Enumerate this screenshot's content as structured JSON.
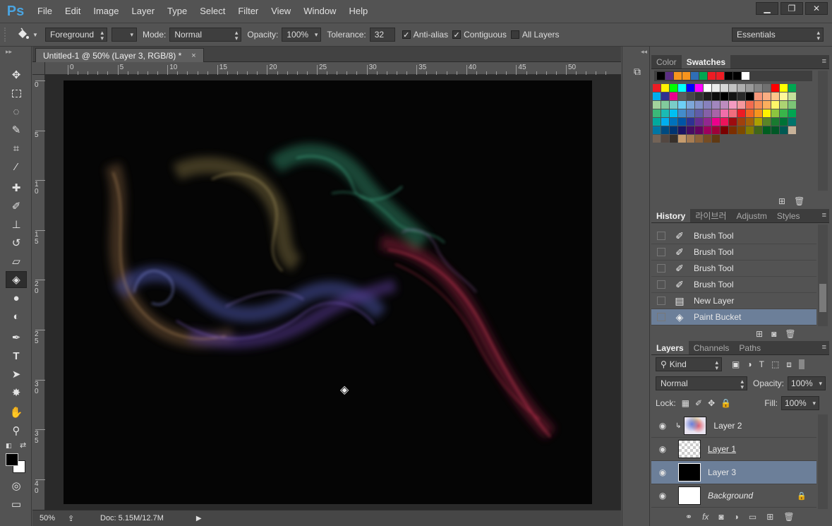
{
  "app": {
    "logo": "Ps",
    "menus": [
      "File",
      "Edit",
      "Image",
      "Layer",
      "Type",
      "Select",
      "Filter",
      "View",
      "Window",
      "Help"
    ],
    "window_controls": [
      "▁",
      "❐",
      "✕"
    ]
  },
  "options": {
    "fill_source": "Foreground",
    "mode_label": "Mode:",
    "mode_value": "Normal",
    "opacity_label": "Opacity:",
    "opacity_value": "100%",
    "tolerance_label": "Tolerance:",
    "tolerance_value": "32",
    "anti_alias": "Anti-alias",
    "contiguous": "Contiguous",
    "all_layers": "All Layers",
    "workspace": "Essentials"
  },
  "document": {
    "tab_title": "Untitled-1 @ 50% (Layer 3, RGB/8) *",
    "close": "×",
    "ruler_top": [
      "0",
      "5",
      "10",
      "15",
      "20",
      "25",
      "30",
      "35",
      "40",
      "45",
      "50"
    ],
    "ruler_left": [
      "0",
      "5",
      "1\n0",
      "1\n5",
      "2\n0",
      "2\n5",
      "3\n0",
      "3\n5",
      "4\n0"
    ],
    "zoom": "50%",
    "doc_size": "Doc: 5.15M/12.7M"
  },
  "swatches_panel": {
    "tabs": [
      "Color",
      "Swatches"
    ],
    "active": "Swatches",
    "row0": [
      "#000000",
      "#5a2d82",
      "#f7941d",
      "#f7941d",
      "#2f6eb5",
      "#00a651",
      "#ed1c24",
      "#ed1c24",
      "#000000",
      "#000000",
      "#ffffff"
    ],
    "grid": [
      [
        "#ed1c24",
        "#fff200",
        "#00ff00",
        "#00ffff",
        "#0000ff",
        "#ff00ff",
        "#ffffff",
        "#ebebeb",
        "#d6d6d6",
        "#c2c2c2",
        "#adadad",
        "#999999",
        "#858585",
        "#707070",
        "#ff0000",
        "#ffff00",
        "#00a651"
      ],
      [
        "#00aeef",
        "#2e3192",
        "#ec008c",
        "#5c5c5c",
        "#474747",
        "#333333",
        "#1f1f1f",
        "#0d0d0d",
        "#000000",
        "#141414",
        "#292929",
        "#000000",
        "#f7977a",
        "#fbad82",
        "#fdc68c",
        "#fff79a",
        "#c4df9b"
      ],
      [
        "#a3d39c",
        "#82ca9c",
        "#7accc8",
        "#6dcff6",
        "#7da7d9",
        "#8393ca",
        "#8781bd",
        "#a187be",
        "#bd8cbf",
        "#f49ac1",
        "#f5989d",
        "#f26c4f",
        "#f68e56",
        "#fbaf5d",
        "#fff568",
        "#acd373",
        "#7cc576"
      ],
      [
        "#3bb878",
        "#1abbb4",
        "#00bff3",
        "#438ccb",
        "#5574b9",
        "#605ca8",
        "#8560a8",
        "#a864a8",
        "#f06eaa",
        "#f26d7d",
        "#ed1c24",
        "#f26522",
        "#f7941d",
        "#fff200",
        "#8dc63f",
        "#39b54a",
        "#00a651"
      ],
      [
        "#00a99d",
        "#00aeef",
        "#0072bc",
        "#0054a6",
        "#2e3192",
        "#662d91",
        "#92278f",
        "#ec008c",
        "#ed145b",
        "#9e0b0f",
        "#a0410d",
        "#a36209",
        "#aba000",
        "#598527",
        "#197b30",
        "#007236",
        "#00746b"
      ],
      [
        "#0076a3",
        "#004a80",
        "#003471",
        "#1b1464",
        "#440e62",
        "#630460",
        "#9e005d",
        "#9e0039",
        "#790000",
        "#7b2e00",
        "#7d4900",
        "#827b00",
        "#406618",
        "#005e20",
        "#005826",
        "#005952",
        "#c7b299"
      ],
      [
        "#736357",
        "#534741",
        "#37302a",
        "#c69c6d",
        "#a67c52",
        "#8c6239",
        "#754c24",
        "#603913"
      ]
    ]
  },
  "history_panel": {
    "tabs": [
      "History",
      "라이브러",
      "Adjustm",
      "Styles"
    ],
    "active": "History",
    "items": [
      {
        "icon": "brush",
        "label": "Brush Tool"
      },
      {
        "icon": "brush",
        "label": "Brush Tool"
      },
      {
        "icon": "brush",
        "label": "Brush Tool"
      },
      {
        "icon": "brush",
        "label": "Brush Tool"
      },
      {
        "icon": "new-layer",
        "label": "New Layer"
      },
      {
        "icon": "paint-bucket",
        "label": "Paint Bucket"
      }
    ],
    "selected_index": 5
  },
  "layers_panel": {
    "tabs": [
      "Layers",
      "Channels",
      "Paths"
    ],
    "active": "Layers",
    "filter_label": "Kind",
    "blend_mode": "Normal",
    "opacity_label": "Opacity:",
    "opacity_value": "100%",
    "lock_label": "Lock:",
    "fill_label": "Fill:",
    "fill_value": "100%",
    "layers": [
      {
        "name": "Layer 2",
        "thumb": "colorful",
        "clipped": true
      },
      {
        "name": "Layer 1",
        "thumb": "transparent",
        "clipped": false
      },
      {
        "name": "Layer 3",
        "thumb": "black",
        "clipped": false
      },
      {
        "name": "Background",
        "thumb": "white",
        "clipped": false,
        "locked": true
      }
    ],
    "selected_index": 2
  },
  "colors": {
    "selection": "#6c7f99",
    "panel_bg": "#535353",
    "canvas_bg": "#050505",
    "accent_logo": "#4aa3df"
  }
}
